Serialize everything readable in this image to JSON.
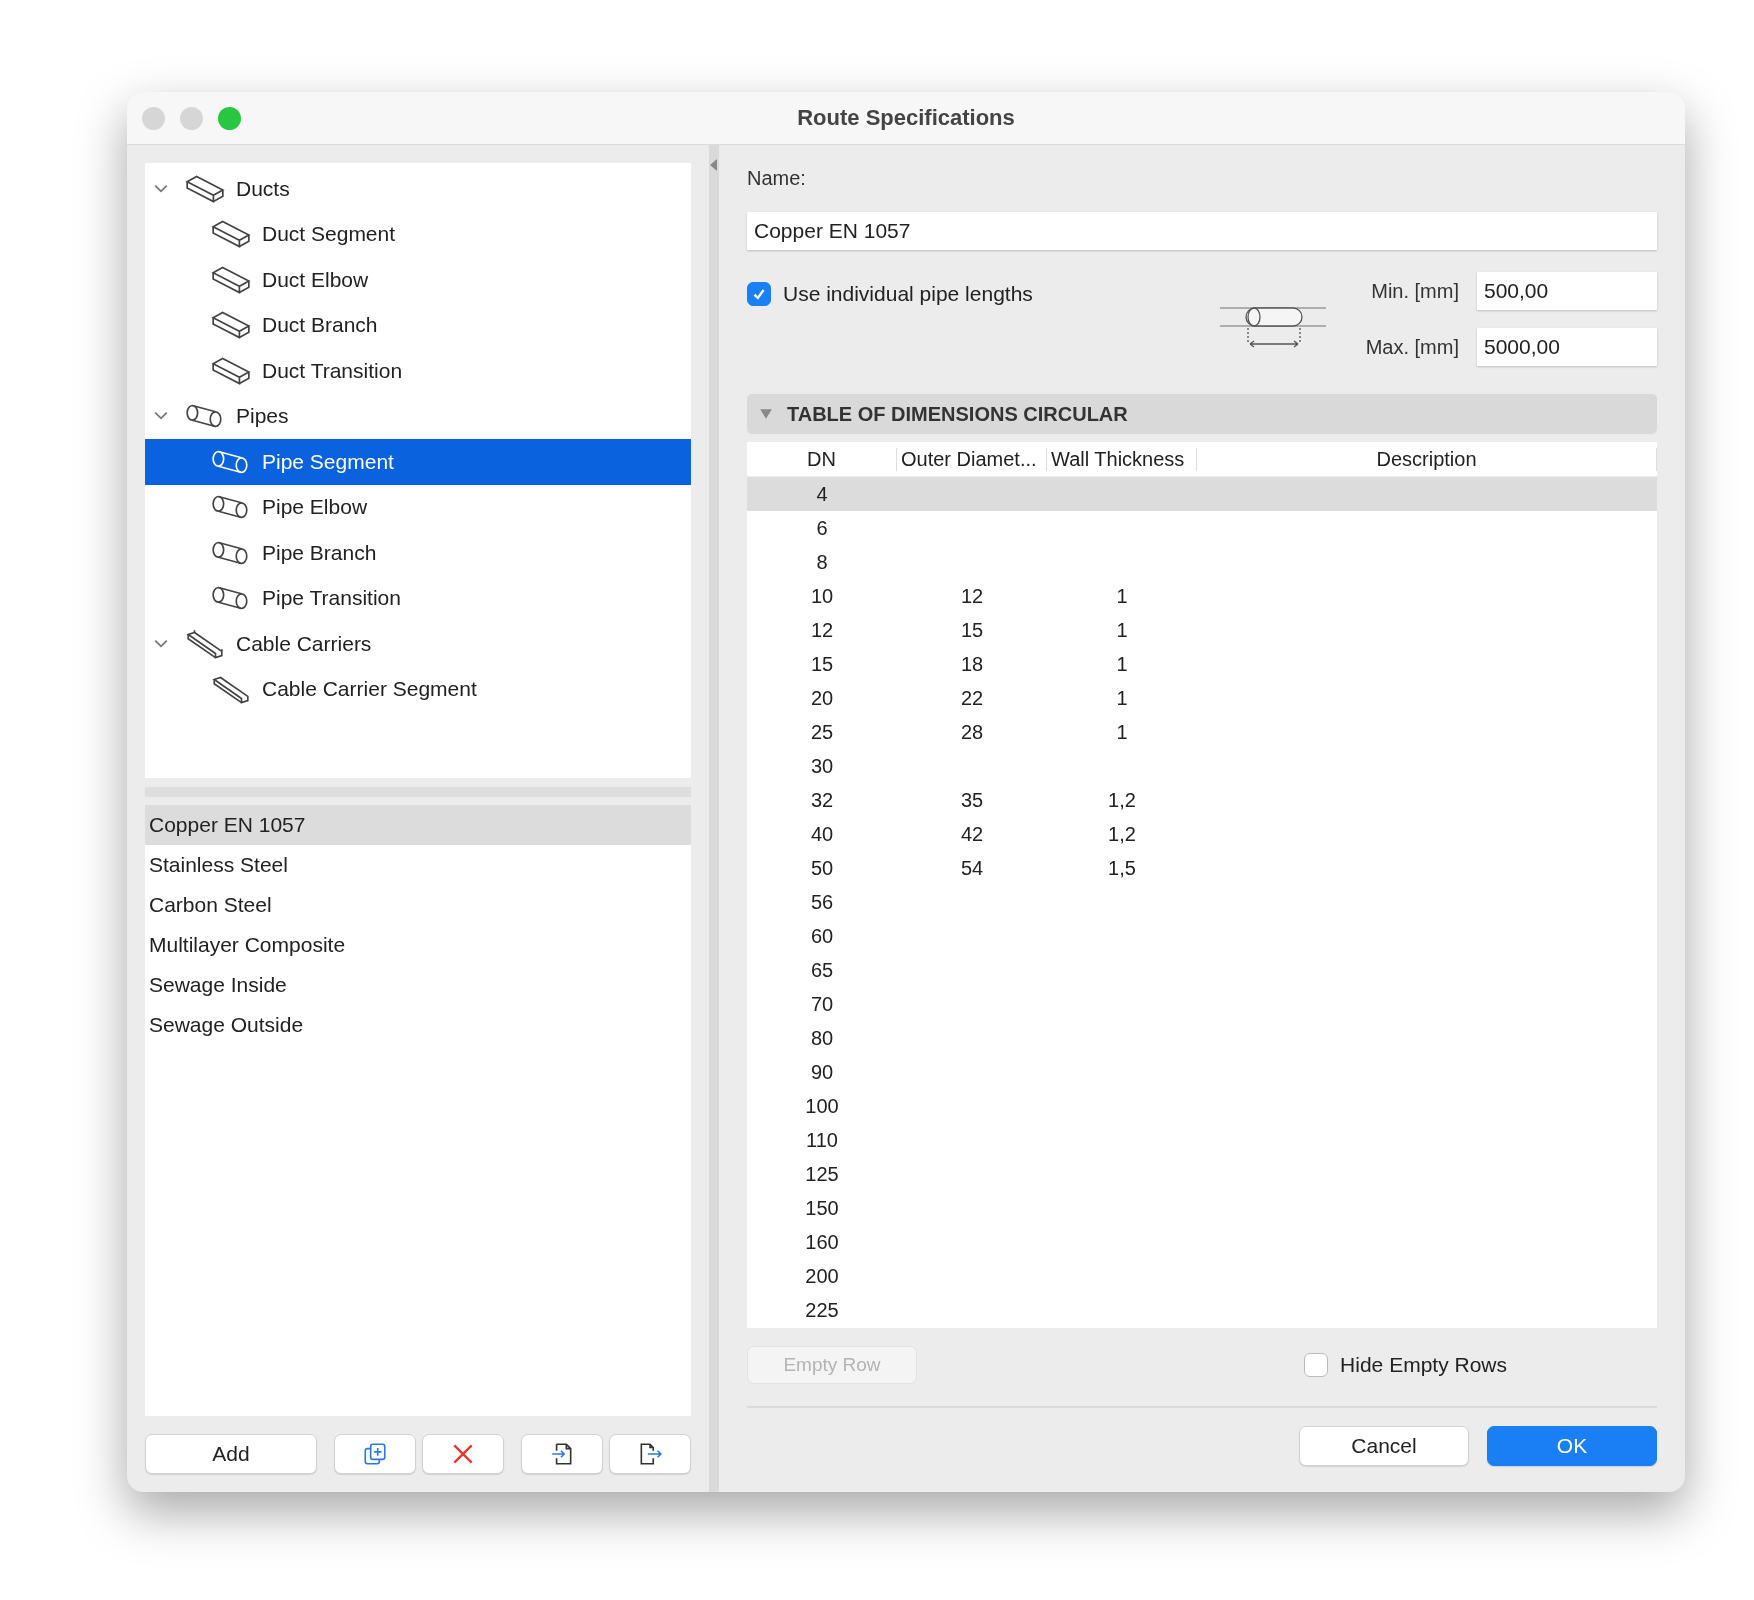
{
  "window": {
    "title": "Route Specifications"
  },
  "tree": [
    {
      "label": "Ducts",
      "expanded": true,
      "children": [
        {
          "label": "Duct Segment",
          "selected": false
        },
        {
          "label": "Duct Elbow",
          "selected": false
        },
        {
          "label": "Duct Branch",
          "selected": false
        },
        {
          "label": "Duct Transition",
          "selected": false
        }
      ]
    },
    {
      "label": "Pipes",
      "expanded": true,
      "children": [
        {
          "label": "Pipe Segment",
          "selected": true
        },
        {
          "label": "Pipe Elbow",
          "selected": false
        },
        {
          "label": "Pipe Branch",
          "selected": false
        },
        {
          "label": "Pipe Transition",
          "selected": false
        }
      ]
    },
    {
      "label": "Cable Carriers",
      "expanded": true,
      "children": [
        {
          "label": "Cable Carrier Segment",
          "selected": false
        }
      ]
    }
  ],
  "materials": [
    {
      "label": "Copper EN 1057",
      "selected": true
    },
    {
      "label": "Stainless Steel",
      "selected": false
    },
    {
      "label": "Carbon Steel",
      "selected": false
    },
    {
      "label": "Multilayer Composite",
      "selected": false
    },
    {
      "label": "Sewage Inside",
      "selected": false
    },
    {
      "label": "Sewage Outside",
      "selected": false
    }
  ],
  "left_buttons": {
    "add": "Add"
  },
  "name_label": "Name:",
  "name_value": "Copper EN 1057",
  "pipe_lengths": {
    "label": "Use individual pipe lengths",
    "checked": true,
    "min_label": "Min. [mm]",
    "min_value": "500,00",
    "max_label": "Max. [mm]",
    "max_value": "5000,00"
  },
  "section": {
    "title": "TABLE OF DIMENSIONS CIRCULAR",
    "expanded": true
  },
  "table": {
    "columns": [
      "DN",
      "Outer Diamet...",
      "Wall Thickness",
      "Description"
    ],
    "rows": [
      {
        "dn": "4",
        "selected": true
      },
      {
        "dn": "6",
        "selected": false
      },
      {
        "dn": "8",
        "selected": false
      },
      {
        "dn": "10",
        "outer": "12",
        "wall": "1",
        "selected": false
      },
      {
        "dn": "12",
        "outer": "15",
        "wall": "1",
        "selected": false
      },
      {
        "dn": "15",
        "outer": "18",
        "wall": "1",
        "selected": false
      },
      {
        "dn": "20",
        "outer": "22",
        "wall": "1",
        "selected": false
      },
      {
        "dn": "25",
        "outer": "28",
        "wall": "1",
        "selected": false
      },
      {
        "dn": "30",
        "selected": false
      },
      {
        "dn": "32",
        "outer": "35",
        "wall": "1,2",
        "selected": false
      },
      {
        "dn": "40",
        "outer": "42",
        "wall": "1,2",
        "selected": false
      },
      {
        "dn": "50",
        "outer": "54",
        "wall": "1,5",
        "selected": false
      },
      {
        "dn": "56",
        "selected": false
      },
      {
        "dn": "60",
        "selected": false
      },
      {
        "dn": "65",
        "selected": false
      },
      {
        "dn": "70",
        "selected": false
      },
      {
        "dn": "80",
        "selected": false
      },
      {
        "dn": "90",
        "selected": false
      },
      {
        "dn": "100",
        "selected": false
      },
      {
        "dn": "110",
        "selected": false
      },
      {
        "dn": "125",
        "selected": false
      },
      {
        "dn": "150",
        "selected": false
      },
      {
        "dn": "160",
        "selected": false
      },
      {
        "dn": "200",
        "selected": false
      },
      {
        "dn": "225",
        "selected": false
      }
    ]
  },
  "empty_row_button": {
    "label": "Empty Row",
    "disabled": true
  },
  "hide_empty_rows": {
    "label": "Hide Empty Rows",
    "checked": false
  },
  "buttons": {
    "cancel": "Cancel",
    "ok": "OK"
  }
}
